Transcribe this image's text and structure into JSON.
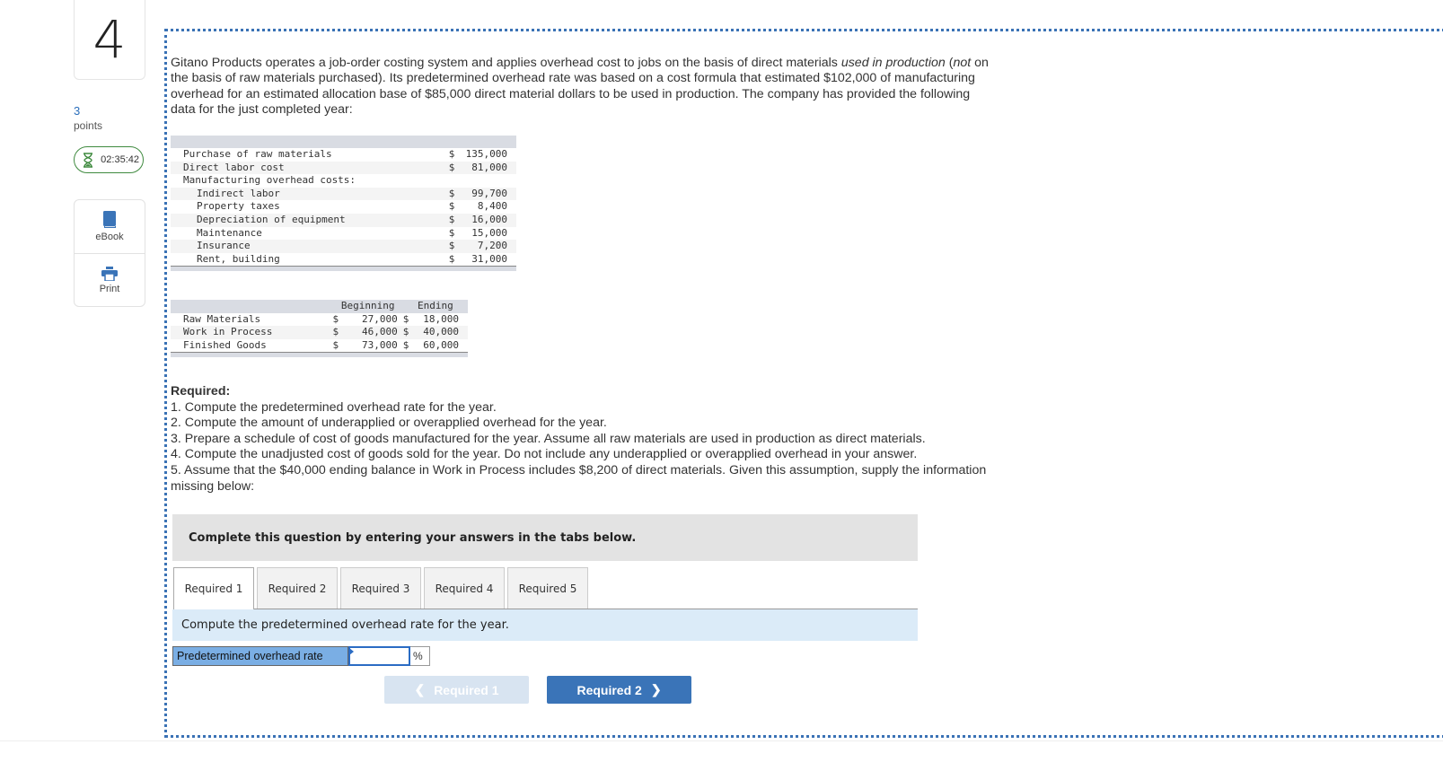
{
  "question": {
    "number": "4",
    "points_value": "3",
    "points_label": "points",
    "timer": "02:35:42"
  },
  "tools": [
    {
      "label": "eBook",
      "icon": "book-icon"
    },
    {
      "label": "Print",
      "icon": "printer-icon"
    }
  ],
  "intro": {
    "p1": "Gitano Products operates a job-order costing system and applies overhead cost to jobs on the basis of direct materials ",
    "em1": "used in production",
    "p2": " (",
    "em2": "not",
    "p3": " on the basis of raw materials purchased). Its predetermined overhead rate was based on a cost formula that estimated $102,000 of manufacturing overhead for an estimated allocation base of $85,000 direct material dollars to be used in production. The company has provided the following data for the just completed year:"
  },
  "cost_table": {
    "rows": [
      {
        "label": "Purchase of raw materials",
        "indent": false,
        "cur": "$",
        "value": "135,000"
      },
      {
        "label": "Direct labor cost",
        "indent": false,
        "cur": "$",
        "value": "81,000"
      },
      {
        "label": "Manufacturing overhead costs:",
        "indent": false,
        "cur": "",
        "value": ""
      },
      {
        "label": "Indirect labor",
        "indent": true,
        "cur": "$",
        "value": "99,700"
      },
      {
        "label": "Property taxes",
        "indent": true,
        "cur": "$",
        "value": "8,400"
      },
      {
        "label": "Depreciation of equipment",
        "indent": true,
        "cur": "$",
        "value": "16,000"
      },
      {
        "label": "Maintenance",
        "indent": true,
        "cur": "$",
        "value": "15,000"
      },
      {
        "label": "Insurance",
        "indent": true,
        "cur": "$",
        "value": "7,200"
      },
      {
        "label": "Rent, building",
        "indent": true,
        "cur": "$",
        "value": "31,000"
      }
    ]
  },
  "inventory_table": {
    "headers": [
      "Beginning",
      "Ending"
    ],
    "rows": [
      {
        "label": "Raw Materials",
        "beginning": "27,000",
        "ending": "18,000"
      },
      {
        "label": "Work in Process",
        "beginning": "46,000",
        "ending": "40,000"
      },
      {
        "label": "Finished Goods",
        "beginning": "73,000",
        "ending": "60,000"
      }
    ],
    "currency": "$"
  },
  "required": {
    "heading": "Required:",
    "items": [
      "1. Compute the predetermined overhead rate for the year.",
      "2. Compute the amount of underapplied or overapplied overhead for the year.",
      "3. Prepare a schedule of cost of goods manufactured for the year. Assume all raw materials are used in production as direct materials.",
      "4. Compute the unadjusted cost of goods sold for the year. Do not include any underapplied or overapplied overhead in your answer.",
      "5. Assume that the $40,000 ending balance in Work in Process includes $8,200 of direct materials. Given this assumption, supply the information missing below:"
    ]
  },
  "instruction": "Complete this question by entering your answers in the tabs below.",
  "tabs": [
    "Required 1",
    "Required 2",
    "Required 3",
    "Required 4",
    "Required 5"
  ],
  "active_tab": 0,
  "tab_prompt": "Compute the predetermined overhead rate for the year.",
  "answer": {
    "label": "Predetermined overhead rate",
    "value": "",
    "unit": "%"
  },
  "nav": {
    "prev_label": "Required 1",
    "next_label": "Required 2"
  },
  "colors": {
    "accent": "#3a74b8",
    "timer_border": "#3f8a3f",
    "answer_label_bg": "#7aaee4",
    "tab_body_bg": "#dbebf8"
  }
}
